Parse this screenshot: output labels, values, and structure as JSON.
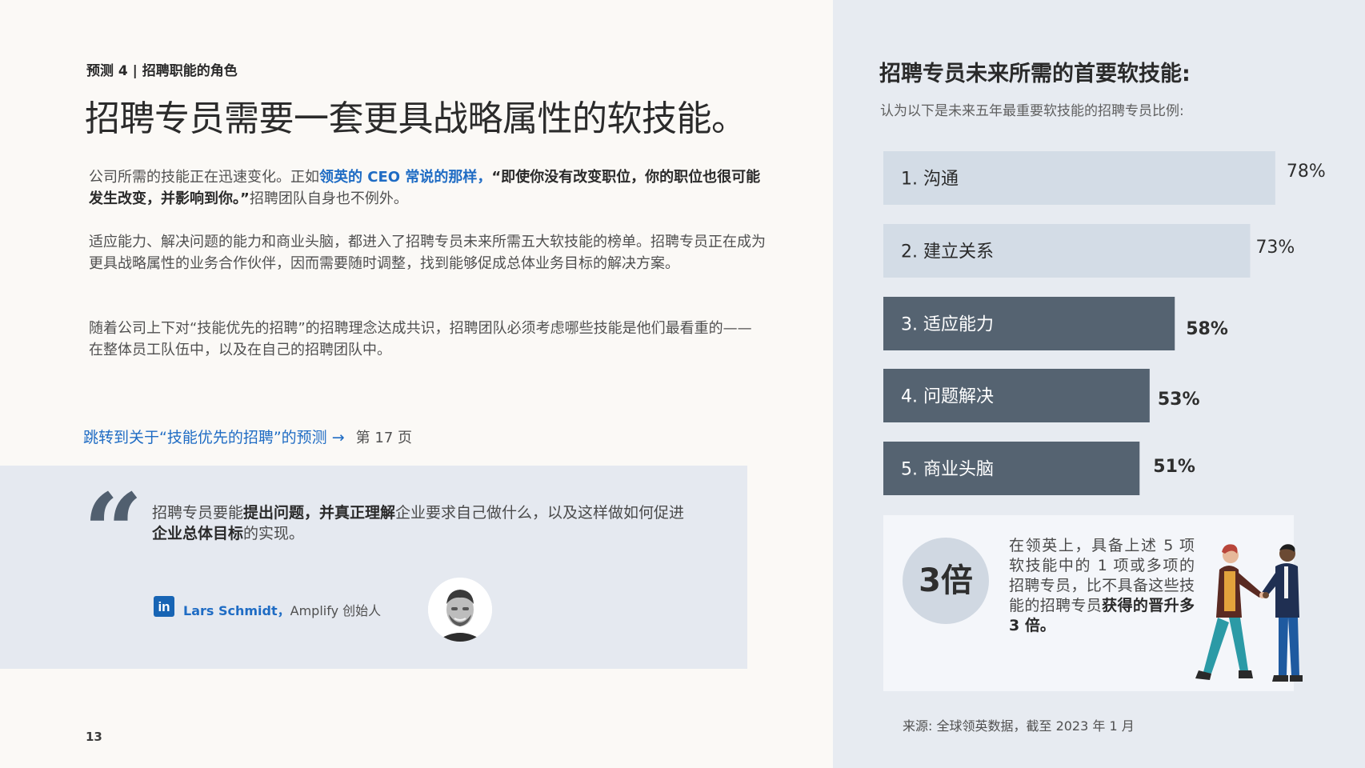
{
  "page": {
    "section_label": "预测 4 | 招聘职能的角色",
    "headline": "招聘专员需要一套更具战略属性的软技能。",
    "page_number": "13"
  },
  "paragraphs": {
    "p1_a": "公司所需的技能正在迅速变化。正如",
    "p1_link": "领英的 CEO 常说的那样",
    "p1_b": "，",
    "p1_quote": "“即使你没有改变职位，你的职位也很可能发生改变，并影响到你。”",
    "p1_c": "招聘团队自身也不例外。",
    "p2": "适应能力、解决问题的能力和商业头脑，都进入了招聘专员未来所需五大软技能的榜单。招聘专员正在成为更具战略属性的业务合作伙伴，因而需要随时调整，找到能够促成总体业务目标的解决方案。",
    "p3": "随着公司上下对“技能优先的招聘”的招聘理念达成共识，招聘团队必须考虑哪些技能是他们最看重的——在整体员工队伍中，以及在自己的招聘团队中。"
  },
  "jump": {
    "link_text": "跳转到关于“技能优先的招聘”的预测",
    "arrow": "→",
    "page_ref": "第 17 页"
  },
  "quote": {
    "mark": "“",
    "part1": "招聘专员要能",
    "bold1": "提出问题，并真正理解",
    "part2": "企业要求自己做什么，以及这样做如何促进",
    "bold2": "企业总体目标",
    "part3": "的实现。",
    "icon_text": "in",
    "author_name": "Lars Schmidt，",
    "author_title": "Amplify 创始人"
  },
  "chart_data": {
    "type": "bar",
    "orientation": "horizontal",
    "title": "招聘专员未来所需的首要软技能:",
    "subtitle": "认为以下是未来五年最重要软技能的招聘专员比例:",
    "categories": [
      "1. 沟通",
      "2. 建立关系",
      "3. 适应能力",
      "4. 问题解决",
      "5. 商业头脑"
    ],
    "values": [
      78,
      73,
      58,
      53,
      51
    ],
    "value_labels": [
      "78%",
      "73%",
      "58%",
      "53%",
      "51%"
    ],
    "colors": [
      "#d3dce6",
      "#d3dce6",
      "#556371",
      "#556371",
      "#556371"
    ],
    "label_colors": [
      "#2a2a2a",
      "#2a2a2a",
      "#ffffff",
      "#ffffff",
      "#ffffff"
    ],
    "value_label_weights": [
      "normal",
      "normal",
      "bold",
      "bold",
      "bold"
    ],
    "xlim": [
      0,
      100
    ]
  },
  "stat": {
    "big": "3倍",
    "text": "在领英上，具备上述 5 项软技能中的 1 项或多项的招聘专员，比不具备这些技能的招聘专员",
    "bold": "获得的晋升多 3 倍。"
  },
  "source_note": "来源: 全球领英数据，截至 2023 年 1 月",
  "colors": {
    "link_blue": "#1f6cc4",
    "panel_bg": "#e7ebf1",
    "quote_bg": "#e5e9f0",
    "dark_slate": "#556371"
  }
}
